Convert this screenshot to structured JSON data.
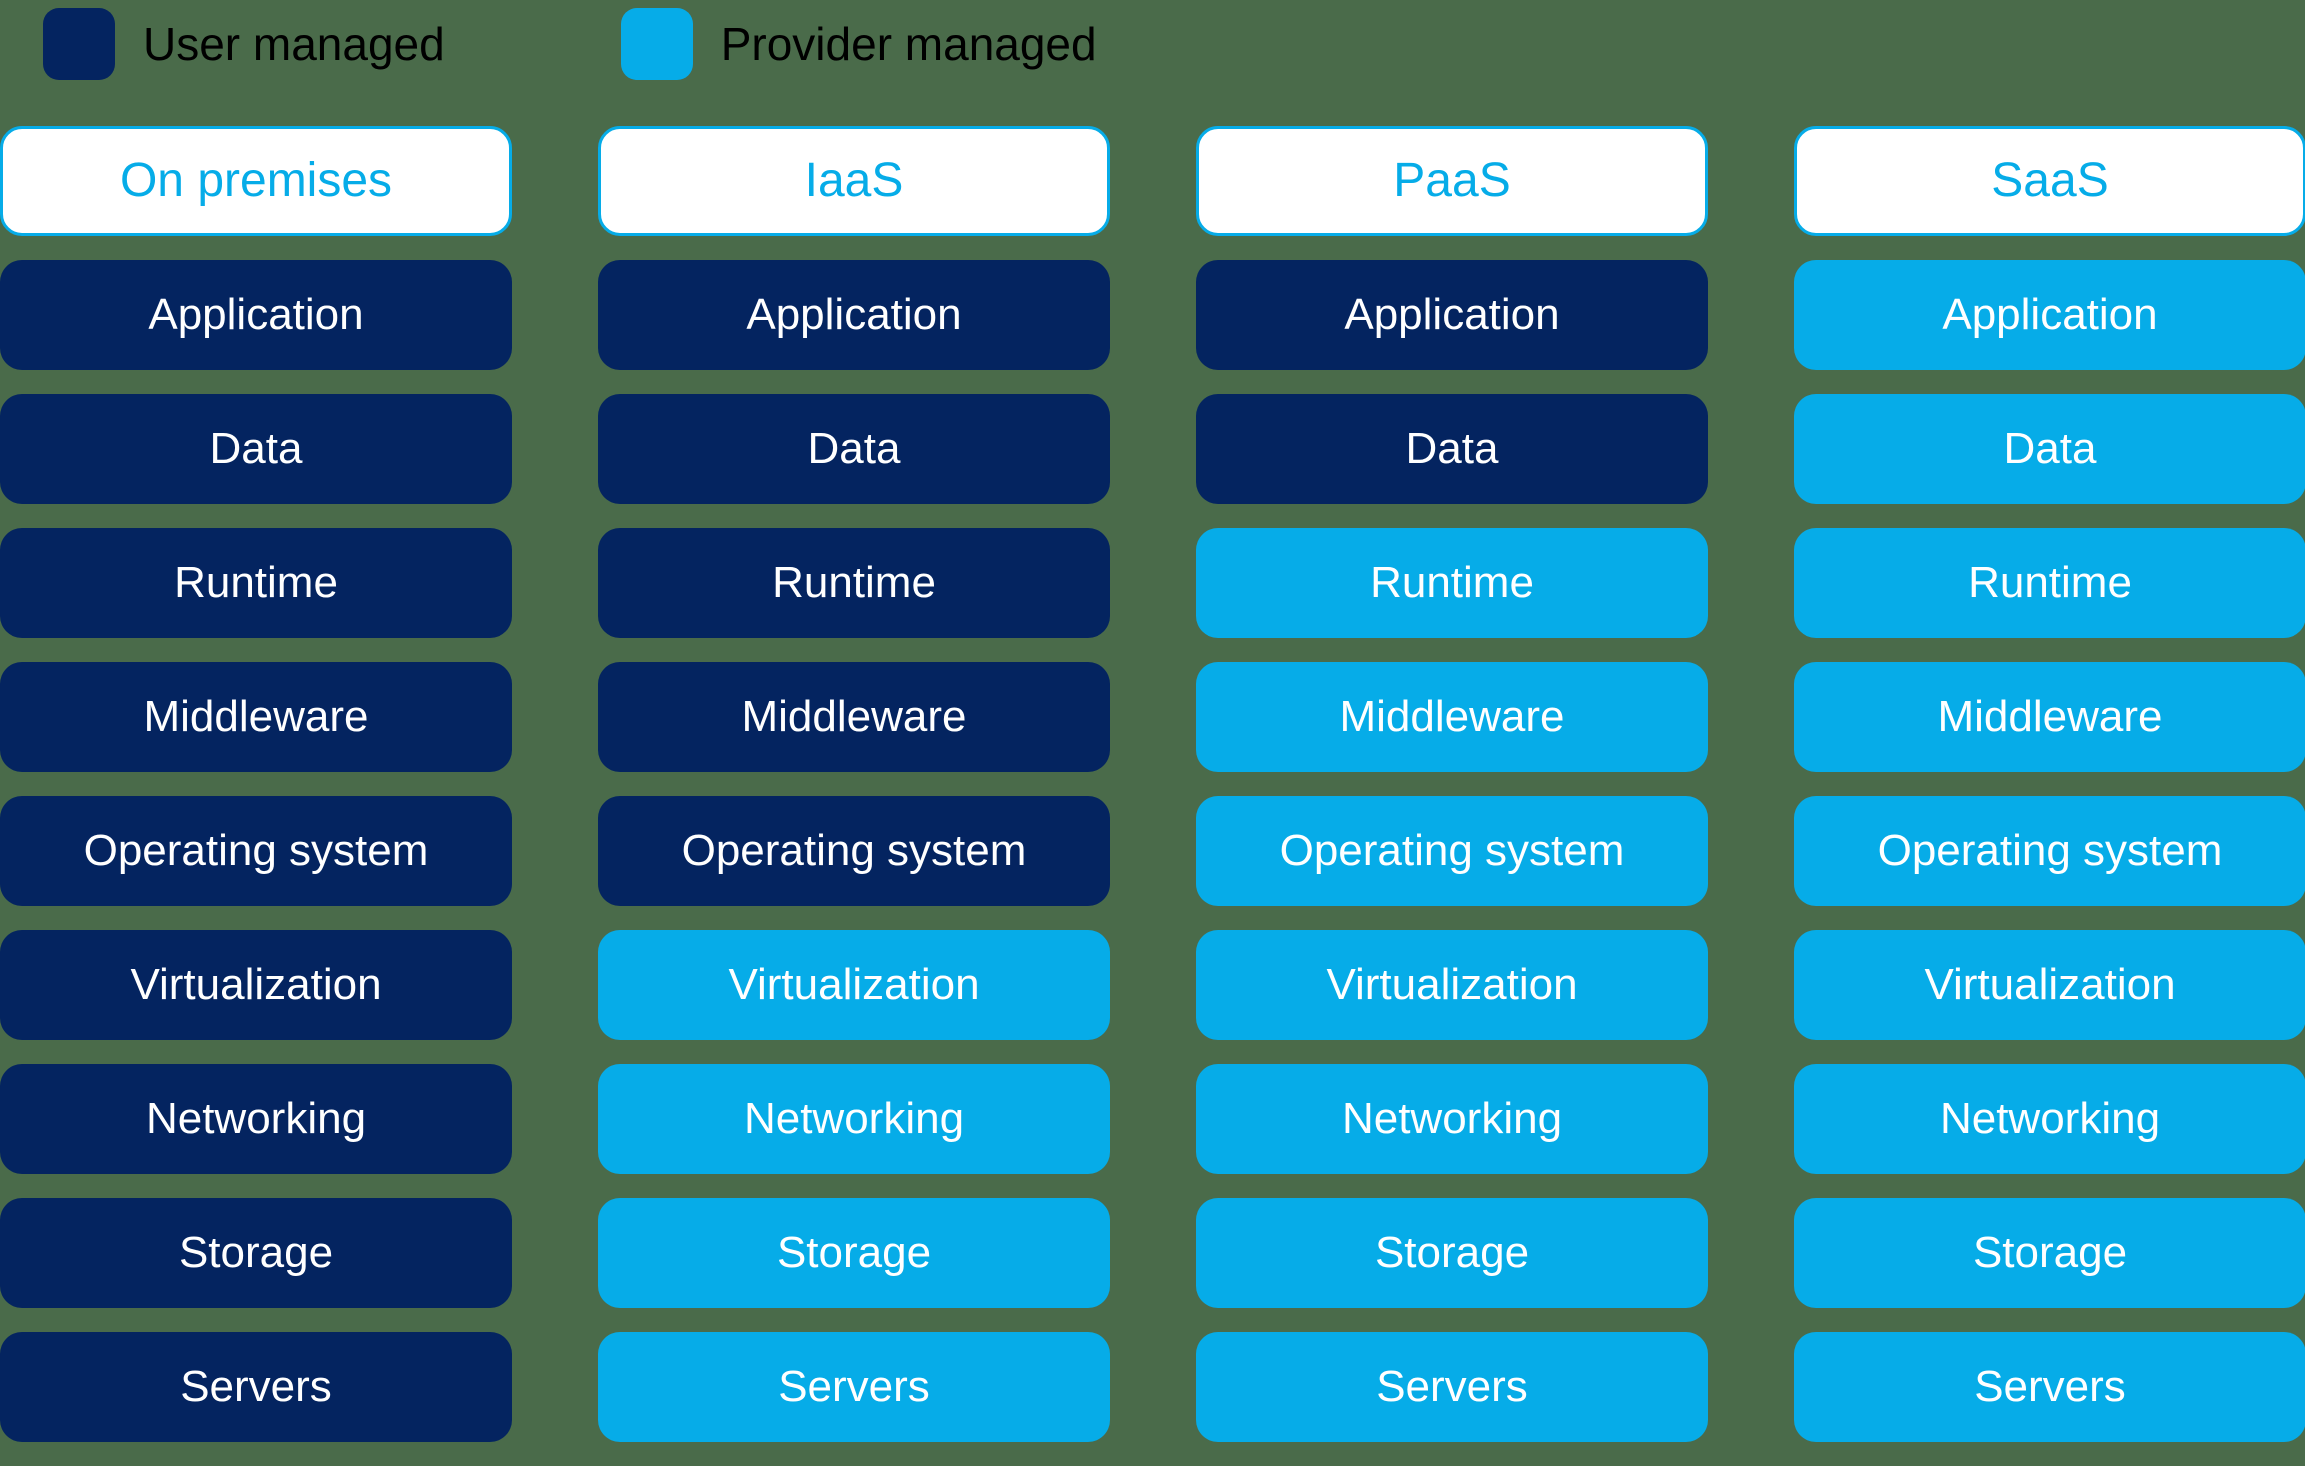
{
  "colors": {
    "user_managed": "#042460",
    "provider_managed": "#06ace8",
    "header_border": "#06ace8",
    "header_text": "#06ace8",
    "header_background": "#ffffff",
    "cell_text": "#ffffff",
    "legend_text": "#000000",
    "background": "#4a6b4a"
  },
  "legend": {
    "items": [
      {
        "label": "User managed",
        "swatch": "user-swatch",
        "key": "user"
      },
      {
        "label": "Provider managed",
        "swatch": "provider-swatch",
        "key": "provider"
      }
    ]
  },
  "layers": [
    "Application",
    "Data",
    "Runtime",
    "Middleware",
    "Operating system",
    "Virtualization",
    "Networking",
    "Storage",
    "Servers"
  ],
  "columns": [
    {
      "header": "On premises",
      "cells": [
        {
          "label": "Application",
          "owner": "user"
        },
        {
          "label": "Data",
          "owner": "user"
        },
        {
          "label": "Runtime",
          "owner": "user"
        },
        {
          "label": "Middleware",
          "owner": "user"
        },
        {
          "label": "Operating system",
          "owner": "user"
        },
        {
          "label": "Virtualization",
          "owner": "user"
        },
        {
          "label": "Networking",
          "owner": "user"
        },
        {
          "label": "Storage",
          "owner": "user"
        },
        {
          "label": "Servers",
          "owner": "user"
        }
      ]
    },
    {
      "header": "IaaS",
      "cells": [
        {
          "label": "Application",
          "owner": "user"
        },
        {
          "label": "Data",
          "owner": "user"
        },
        {
          "label": "Runtime",
          "owner": "user"
        },
        {
          "label": "Middleware",
          "owner": "user"
        },
        {
          "label": "Operating system",
          "owner": "user"
        },
        {
          "label": "Virtualization",
          "owner": "provider"
        },
        {
          "label": "Networking",
          "owner": "provider"
        },
        {
          "label": "Storage",
          "owner": "provider"
        },
        {
          "label": "Servers",
          "owner": "provider"
        }
      ]
    },
    {
      "header": "PaaS",
      "cells": [
        {
          "label": "Application",
          "owner": "user"
        },
        {
          "label": "Data",
          "owner": "user"
        },
        {
          "label": "Runtime",
          "owner": "provider"
        },
        {
          "label": "Middleware",
          "owner": "provider"
        },
        {
          "label": "Operating system",
          "owner": "provider"
        },
        {
          "label": "Virtualization",
          "owner": "provider"
        },
        {
          "label": "Networking",
          "owner": "provider"
        },
        {
          "label": "Storage",
          "owner": "provider"
        },
        {
          "label": "Servers",
          "owner": "provider"
        }
      ]
    },
    {
      "header": "SaaS",
      "cells": [
        {
          "label": "Application",
          "owner": "provider"
        },
        {
          "label": "Data",
          "owner": "provider"
        },
        {
          "label": "Runtime",
          "owner": "provider"
        },
        {
          "label": "Middleware",
          "owner": "provider"
        },
        {
          "label": "Operating system",
          "owner": "provider"
        },
        {
          "label": "Virtualization",
          "owner": "provider"
        },
        {
          "label": "Networking",
          "owner": "provider"
        },
        {
          "label": "Storage",
          "owner": "provider"
        },
        {
          "label": "Servers",
          "owner": "provider"
        }
      ]
    }
  ]
}
